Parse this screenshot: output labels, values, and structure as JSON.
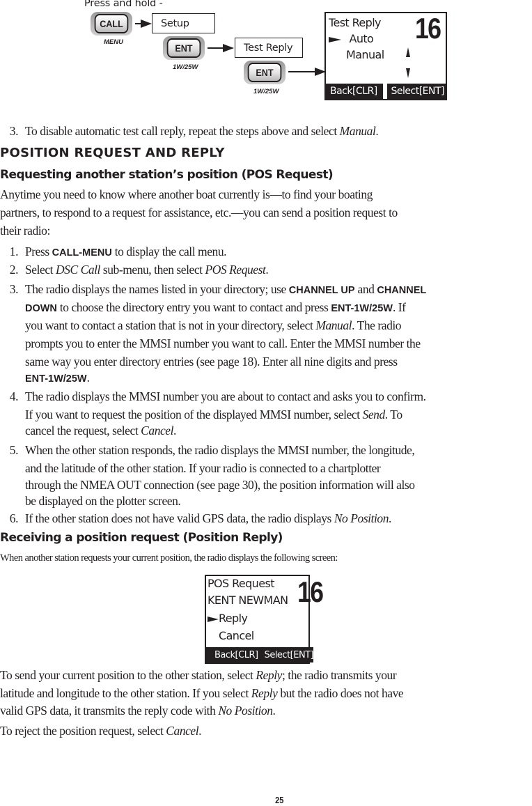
{
  "diagram": {
    "press_hold_label": "Press and hold -",
    "call_button": {
      "label": "CALL",
      "sub_label": "MENU"
    },
    "ent_button_1": {
      "label": "ENT",
      "sub_label": "1W/25W"
    },
    "ent_button_2": {
      "label": "ENT",
      "sub_label": "1W/25W"
    },
    "menu_setup": "Setup",
    "menu_test_reply": "Test Reply",
    "screen": {
      "title": "Test Reply",
      "options": [
        "Auto",
        "Manual"
      ],
      "selected_index": 0,
      "channel": "16",
      "soft_left": "Back[CLR]",
      "soft_right": "Select[ENT]"
    }
  },
  "step3_prev": {
    "number": "3.",
    "text_before": "To disable automatic test call reply, repeat the steps above and select ",
    "italic": "Manual",
    "text_after": "."
  },
  "section_title": "POSITION REQUEST AND REPLY",
  "pos_request": {
    "heading": "Requesting another station’s position (POS Request)",
    "intro_lines": [
      "Anytime you need to know where another boat currently is—to find your boating",
      "partners, to respond to a request for assistance, etc.—you can send a position request to",
      "their radio:"
    ],
    "steps": [
      {
        "number": "1.",
        "parts": [
          {
            "t": "Press "
          },
          {
            "b": "CALL-MENU"
          },
          {
            "t": " to display the call menu."
          }
        ]
      },
      {
        "number": "2.",
        "parts": [
          {
            "t": "Select "
          },
          {
            "i": "DSC Call"
          },
          {
            "t": " sub-menu, then select "
          },
          {
            "i": "POS Request"
          },
          {
            "t": "."
          }
        ]
      },
      {
        "number": "3.",
        "lines": [
          [
            {
              "t": "The radio displays the names listed in your directory; use "
            },
            {
              "b": "CHANNEL UP"
            },
            {
              "t": " and "
            },
            {
              "b": "CHANNEL"
            }
          ],
          [
            {
              "b": "DOWN"
            },
            {
              "t": "  to choose the directory entry you want to contact and press "
            },
            {
              "b": "ENT-1W/25W"
            },
            {
              "t": ". If"
            }
          ],
          [
            {
              "t": "you want to contact a station that is not in your directory, select "
            },
            {
              "i": "Manual"
            },
            {
              "t": ". The radio"
            }
          ],
          [
            {
              "t": "prompts you to enter the MMSI number you want to call. Enter the MMSI number the"
            }
          ],
          [
            {
              "t": "same way you enter directory entries (see page 18). Enter all nine digits and press"
            }
          ],
          [
            {
              "b": "ENT-1W/25W"
            },
            {
              "t": "."
            }
          ]
        ]
      },
      {
        "number": "4.",
        "lines": [
          [
            {
              "t": "The radio displays the MMSI number you are about to contact and asks you to confirm."
            }
          ],
          [
            {
              "t": "If you want to request the position of the displayed MMSI number, select "
            },
            {
              "i": "Send"
            },
            {
              "t": ". To"
            }
          ],
          [
            {
              "t": "cancel the request, select "
            },
            {
              "i": "Cancel"
            },
            {
              "t": "."
            }
          ]
        ]
      },
      {
        "number": "5.",
        "lines": [
          [
            {
              "t": "When the other station responds, the radio displays the MMSI number, the longitude,"
            }
          ],
          [
            {
              "t": "and the latitude of the other station. If your radio is connected to a chartplotter"
            }
          ],
          [
            {
              "t": "through the NMEA OUT connection (see page 30), the position information will also"
            }
          ],
          [
            {
              "t": "be displayed on the plotter screen."
            }
          ]
        ]
      },
      {
        "number": "6.",
        "parts": [
          {
            "t": "If the other station does not have valid GPS data, the radio displays "
          },
          {
            "i": "No Position"
          },
          {
            "t": "."
          }
        ]
      }
    ]
  },
  "pos_reply": {
    "heading": "Receiving a position request (Position Reply)",
    "intro": "When another station requests your current position, the radio displays the following screen:",
    "screen": {
      "line1": "POS Request",
      "line2": "KENT NEWMAN",
      "options": [
        "Reply",
        "Cancel"
      ],
      "selected_index": 0,
      "channel": "16",
      "soft_left": "Back[CLR]",
      "soft_right": "Select[ENT]"
    },
    "para1_lines": [
      [
        {
          "t": "To send your current position to the other station, select "
        },
        {
          "i": "Reply"
        },
        {
          "t": "; the radio transmits your"
        }
      ],
      [
        {
          "t": "latitude and longitude to the other station. If you select "
        },
        {
          "i": "Reply"
        },
        {
          "t": " but the radio does not have"
        }
      ],
      [
        {
          "t": "valid GPS data, it transmits the reply code with "
        },
        {
          "i": "No Position"
        },
        {
          "t": "."
        }
      ]
    ],
    "para2_lines": [
      [
        {
          "t": "To reject the position request, select "
        },
        {
          "i": "Cancel"
        },
        {
          "t": "."
        }
      ]
    ]
  },
  "page_number": "25"
}
